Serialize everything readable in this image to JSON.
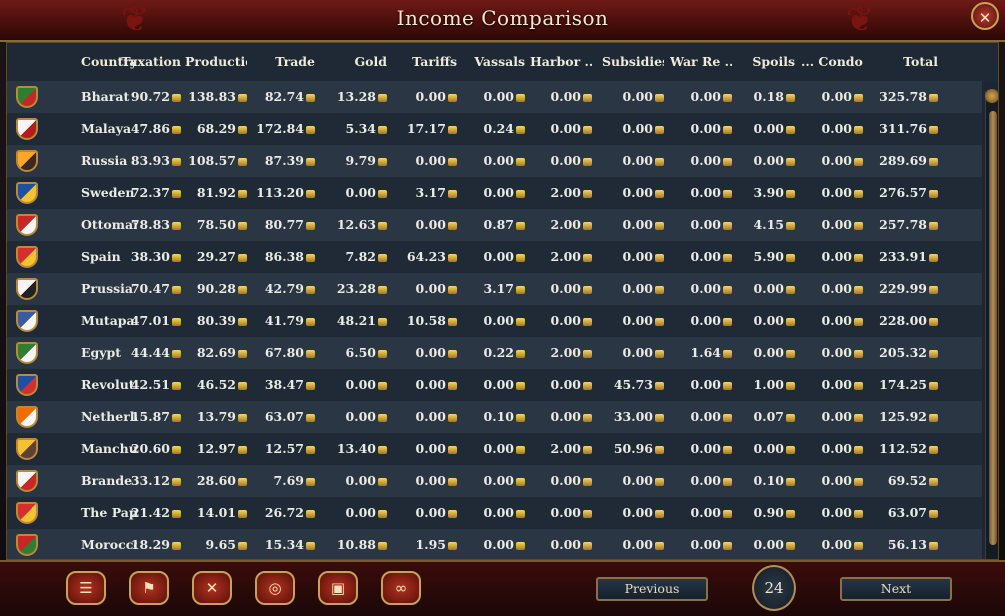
{
  "window": {
    "title": "Income Comparison",
    "close_label": "✕"
  },
  "columns": [
    "Country",
    "Taxation",
    "Production",
    "Trade",
    "Gold",
    "Tariffs",
    "Vassals",
    "Harbor ...",
    "Subsidies",
    "War Re ...",
    "Spoils",
    "... Condottieri",
    "Total"
  ],
  "rows": [
    {
      "country": "Bharat",
      "colors": [
        "#2e7d32",
        "#c62828"
      ],
      "values": [
        "90.72",
        "138.83",
        "82.74",
        "13.28",
        "0.00",
        "0.00",
        "0.00",
        "0.00",
        "0.00",
        "0.18",
        "0.00",
        "325.78"
      ]
    },
    {
      "country": "Malaya",
      "colors": [
        "#f5f5f5",
        "#b71c1c"
      ],
      "values": [
        "47.86",
        "68.29",
        "172.84",
        "5.34",
        "17.17",
        "0.24",
        "0.00",
        "0.00",
        "0.00",
        "0.00",
        "0.00",
        "311.76"
      ]
    },
    {
      "country": "Russia",
      "colors": [
        "#f9a825",
        "#3e2723"
      ],
      "values": [
        "83.93",
        "108.57",
        "87.39",
        "9.79",
        "0.00",
        "0.00",
        "0.00",
        "0.00",
        "0.00",
        "0.00",
        "0.00",
        "289.69"
      ]
    },
    {
      "country": "Sweden",
      "colors": [
        "#1e4fa3",
        "#f2c230"
      ],
      "values": [
        "72.37",
        "81.92",
        "113.20",
        "0.00",
        "3.17",
        "0.00",
        "2.00",
        "0.00",
        "0.00",
        "3.90",
        "0.00",
        "276.57"
      ]
    },
    {
      "country": "Ottomans",
      "colors": [
        "#c62828",
        "#f5f5f5"
      ],
      "values": [
        "78.83",
        "78.50",
        "80.77",
        "12.63",
        "0.00",
        "0.87",
        "2.00",
        "0.00",
        "0.00",
        "4.15",
        "0.00",
        "257.78"
      ]
    },
    {
      "country": "Spain",
      "colors": [
        "#d32f2f",
        "#f2c230"
      ],
      "values": [
        "38.30",
        "29.27",
        "86.38",
        "7.82",
        "64.23",
        "0.00",
        "2.00",
        "0.00",
        "0.00",
        "5.90",
        "0.00",
        "233.91"
      ]
    },
    {
      "country": "Prussia",
      "colors": [
        "#f5f5f5",
        "#212121"
      ],
      "values": [
        "70.47",
        "90.28",
        "42.79",
        "23.28",
        "0.00",
        "3.17",
        "0.00",
        "0.00",
        "0.00",
        "0.00",
        "0.00",
        "229.99"
      ]
    },
    {
      "country": "Mutapa",
      "colors": [
        "#3a5ba0",
        "#f5f5f5"
      ],
      "values": [
        "47.01",
        "80.39",
        "41.79",
        "48.21",
        "10.58",
        "0.00",
        "0.00",
        "0.00",
        "0.00",
        "0.00",
        "0.00",
        "228.00"
      ]
    },
    {
      "country": "Egypt",
      "colors": [
        "#2e7d32",
        "#f5f5f5"
      ],
      "values": [
        "44.44",
        "82.69",
        "67.80",
        "6.50",
        "0.00",
        "0.22",
        "2.00",
        "0.00",
        "1.64",
        "0.00",
        "0.00",
        "205.32"
      ]
    },
    {
      "country": "Revolut ...",
      "colors": [
        "#1e4fa3",
        "#d32f2f"
      ],
      "values": [
        "42.51",
        "46.52",
        "38.47",
        "0.00",
        "0.00",
        "0.00",
        "0.00",
        "45.73",
        "0.00",
        "1.00",
        "0.00",
        "174.25"
      ]
    },
    {
      "country": "Netherlands",
      "colors": [
        "#ef6c00",
        "#f5f5f5"
      ],
      "values": [
        "15.87",
        "13.79",
        "63.07",
        "0.00",
        "0.00",
        "0.10",
        "0.00",
        "33.00",
        "0.00",
        "0.07",
        "0.00",
        "125.92"
      ]
    },
    {
      "country": "Manchu",
      "colors": [
        "#f2c230",
        "#5d4037"
      ],
      "values": [
        "20.60",
        "12.97",
        "12.57",
        "13.40",
        "0.00",
        "0.00",
        "2.00",
        "50.96",
        "0.00",
        "0.00",
        "0.00",
        "112.52"
      ]
    },
    {
      "country": "Brande ...",
      "colors": [
        "#f5f5f5",
        "#c62828"
      ],
      "values": [
        "33.12",
        "28.60",
        "7.69",
        "0.00",
        "0.00",
        "0.00",
        "0.00",
        "0.00",
        "0.00",
        "0.10",
        "0.00",
        "69.52"
      ]
    },
    {
      "country": "The Pap ...",
      "colors": [
        "#d32f2f",
        "#f2c230"
      ],
      "values": [
        "21.42",
        "14.01",
        "26.72",
        "0.00",
        "0.00",
        "0.00",
        "0.00",
        "0.00",
        "0.00",
        "0.90",
        "0.00",
        "63.07"
      ]
    },
    {
      "country": "Morocco",
      "colors": [
        "#c62828",
        "#2e7d32"
      ],
      "values": [
        "18.29",
        "9.65",
        "15.34",
        "10.88",
        "1.95",
        "0.00",
        "0.00",
        "0.00",
        "0.00",
        "0.00",
        "0.00",
        "56.13"
      ]
    }
  ],
  "bottom_buttons": [
    {
      "name": "ledger-button",
      "icon": "scroll-icon",
      "glyph": "☰"
    },
    {
      "name": "flag-button",
      "icon": "flag-icon",
      "glyph": "⚑"
    },
    {
      "name": "military-button",
      "icon": "crossed-swords-icon",
      "glyph": "✕"
    },
    {
      "name": "income-button",
      "icon": "coins-icon",
      "glyph": "◎"
    },
    {
      "name": "trade-button",
      "icon": "crate-icon",
      "glyph": "▣"
    },
    {
      "name": "diplomacy-button",
      "icon": "handshake-icon",
      "glyph": "∞"
    }
  ],
  "pagination": {
    "previous_label": "Previous",
    "next_label": "Next",
    "page": "24"
  }
}
